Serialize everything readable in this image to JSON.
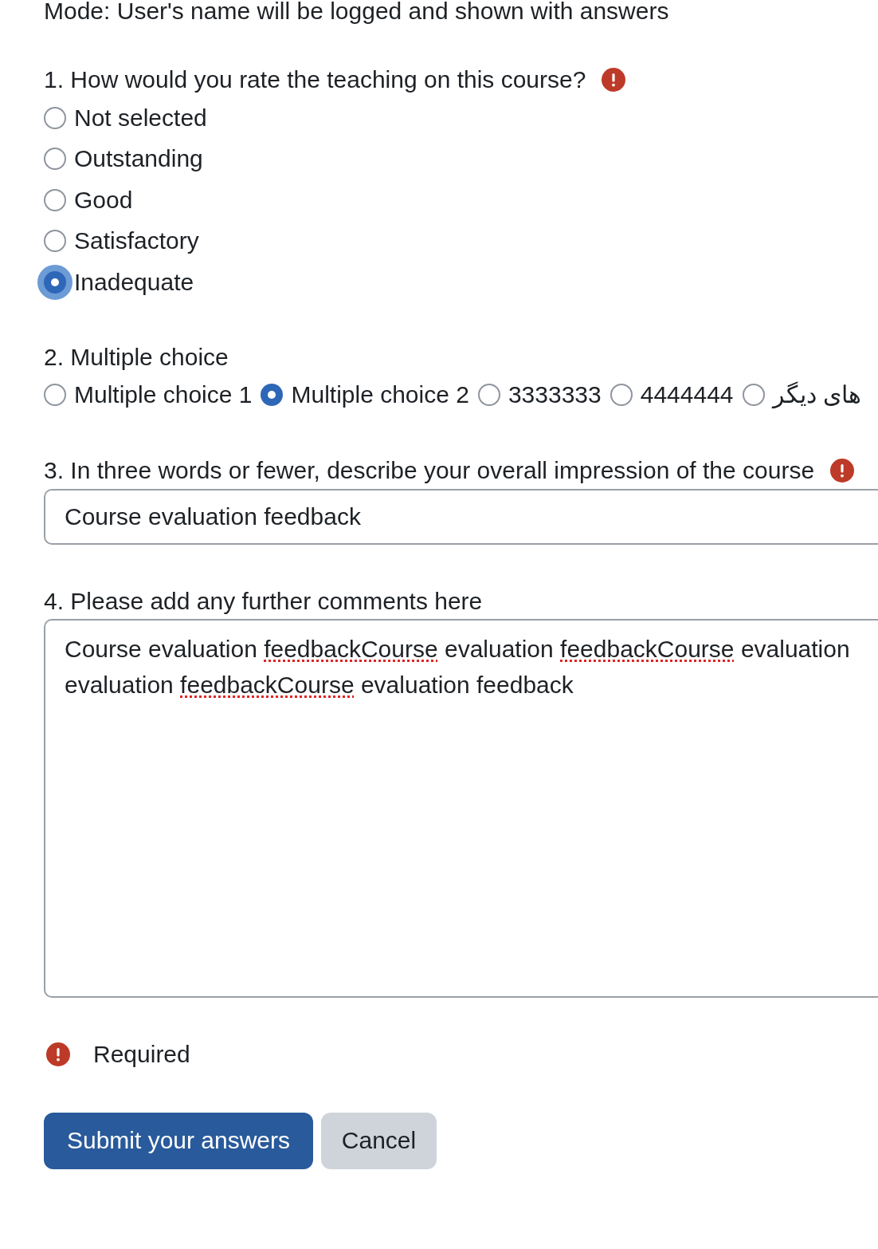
{
  "mode_notice": "Mode: User's name will be logged and shown with answers",
  "questions": [
    {
      "kind": "radio_list",
      "label": "1. How would you rate the teaching on this course?",
      "required": true,
      "options": [
        {
          "label": "Not selected",
          "selected": false,
          "focused": false
        },
        {
          "label": "Outstanding",
          "selected": false,
          "focused": false
        },
        {
          "label": "Good",
          "selected": false,
          "focused": false
        },
        {
          "label": "Satisfactory",
          "selected": false,
          "focused": false
        },
        {
          "label": "Inadequate",
          "selected": true,
          "focused": true
        }
      ]
    },
    {
      "kind": "radio_inline",
      "label": "2. Multiple choice",
      "required": false,
      "options": [
        {
          "label": "Multiple choice 1",
          "selected": false
        },
        {
          "label": "Multiple choice 2",
          "selected": true
        },
        {
          "label": "3333333",
          "selected": false
        },
        {
          "label": "4444444",
          "selected": false
        },
        {
          "label": "های دیگر",
          "selected": false
        }
      ]
    },
    {
      "kind": "text_field",
      "label": "3. In three words or fewer, describe your overall impression of the course",
      "required": true,
      "value": "Course evaluation feedback"
    },
    {
      "kind": "text_area",
      "label": "4. Please add any further comments here",
      "required": false,
      "lines": [
        [
          {
            "text": "Course evaluation ",
            "misspelled": false
          },
          {
            "text": "feedbackCourse",
            "misspelled": true
          },
          {
            "text": " evaluation ",
            "misspelled": false
          },
          {
            "text": "feedbackCourse",
            "misspelled": true
          },
          {
            "text": " evaluation",
            "misspelled": false
          }
        ],
        [
          {
            "text": "evaluation ",
            "misspelled": false
          },
          {
            "text": "feedbackCourse",
            "misspelled": true
          },
          {
            "text": " evaluation feedback",
            "misspelled": false
          }
        ]
      ]
    }
  ],
  "legend": {
    "label": "Required"
  },
  "buttons": [
    {
      "label": "Submit your answers",
      "kind": "primary"
    },
    {
      "label": "Cancel",
      "kind": "secondary"
    }
  ]
}
